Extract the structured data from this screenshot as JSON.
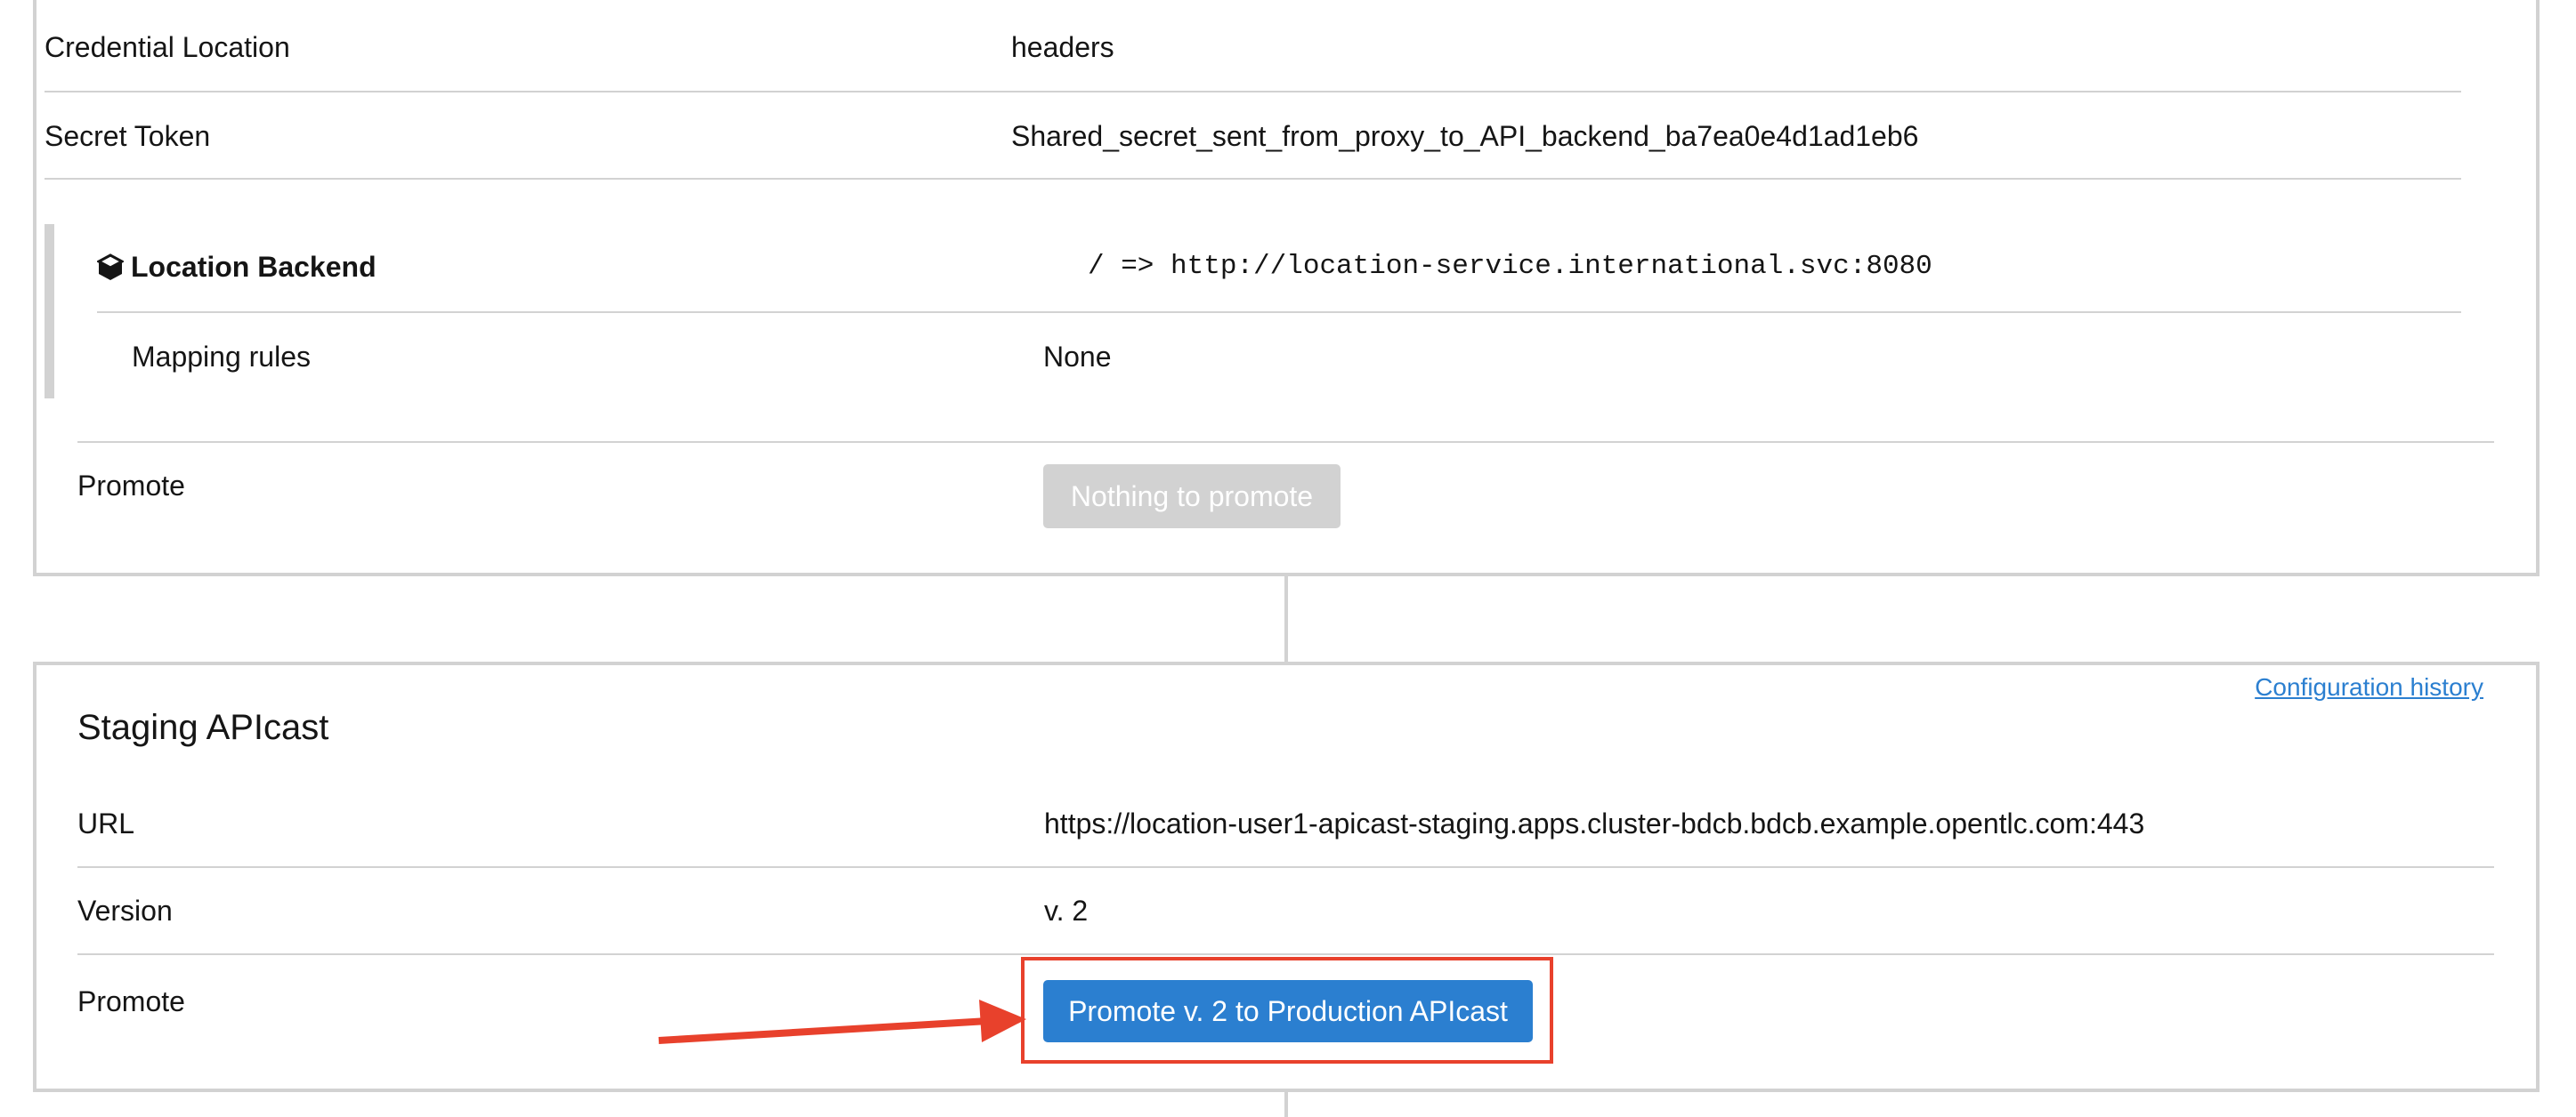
{
  "top_card": {
    "rows": [
      {
        "label": "Credential Location",
        "value": "headers"
      },
      {
        "label": "Secret Token",
        "value": "Shared_secret_sent_from_proxy_to_API_backend_ba7ea0e4d1ad1eb6"
      }
    ],
    "backend": {
      "name": "Location Backend",
      "icon": "cube-icon",
      "route": "/ => http://location-service.international.svc:8080",
      "mapping_label": "Mapping rules",
      "mapping_value": "None"
    },
    "promote_label": "Promote",
    "promote_button": "Nothing to promote"
  },
  "staging_card": {
    "config_history_link": "Configuration history",
    "title": "Staging APIcast",
    "rows": [
      {
        "label": "URL",
        "value": "https://location-user1-apicast-staging.apps.cluster-bdcb.bdcb.example.opentlc.com:443"
      },
      {
        "label": "Version",
        "value": "v. 2"
      }
    ],
    "promote_label": "Promote",
    "promote_button": "Promote v. 2 to Production APIcast"
  },
  "colors": {
    "primary": "#2b7fd0",
    "annotation": "#e8412c",
    "border": "#d2d2d2"
  }
}
